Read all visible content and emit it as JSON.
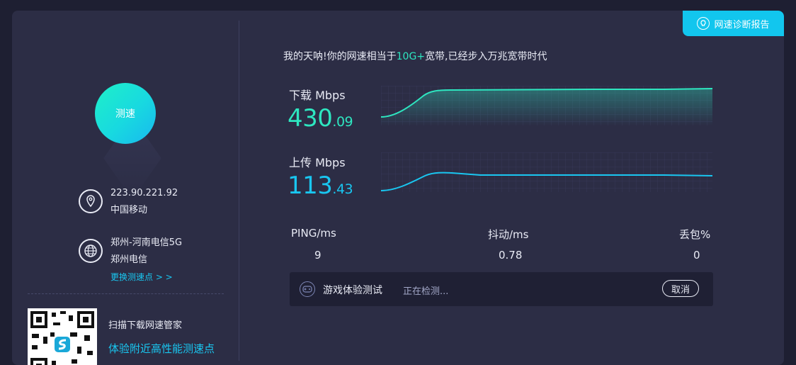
{
  "header": {
    "report_button": "网速诊断报告",
    "report_icon": "diagnosis-bulb-icon"
  },
  "left": {
    "speed_button": "测速",
    "ip": {
      "address": "223.90.221.92",
      "isp": "中国移动",
      "icon": "location-pin-icon"
    },
    "node": {
      "name": "郑州-河南电信5G",
      "isp": "郑州电信",
      "change_link": "更换测速点 > >",
      "icon": "globe-icon"
    },
    "qr": {
      "line1": "扫描下载网速管家",
      "line2": "体验附近高性能测速点"
    }
  },
  "headline": {
    "prefix": "我的天呐!你的网速相当于",
    "highlight": "10G+",
    "suffix": "宽带,已经步入万兆宽带时代"
  },
  "download": {
    "label": "下载 Mbps",
    "int": "430",
    "dec": ".09"
  },
  "upload": {
    "label": "上传 Mbps",
    "int": "113",
    "dec": ".43"
  },
  "stats": {
    "ping": {
      "label": "PING/ms",
      "value": "9"
    },
    "jitter": {
      "label": "抖动/ms",
      "value": "0.78"
    },
    "loss": {
      "label": "丢包%",
      "value": "0"
    }
  },
  "game": {
    "title": "游戏体验测试",
    "status": "正在检测...",
    "cancel": "取消",
    "icon": "gamepad-icon"
  },
  "colors": {
    "accent_green": "#2ee6c0",
    "accent_blue": "#19c6f0",
    "panel": "#2c2d45"
  }
}
